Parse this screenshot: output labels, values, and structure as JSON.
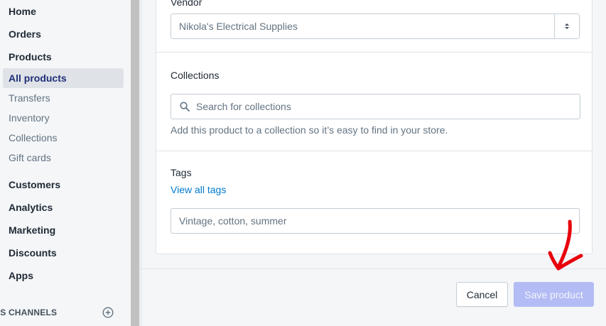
{
  "sidebar": {
    "items": [
      {
        "label": "Home",
        "type": "main"
      },
      {
        "label": "Orders",
        "type": "main"
      },
      {
        "label": "Products",
        "type": "main"
      },
      {
        "label": "All products",
        "type": "active"
      },
      {
        "label": "Transfers",
        "type": "sub"
      },
      {
        "label": "Inventory",
        "type": "sub"
      },
      {
        "label": "Collections",
        "type": "sub"
      },
      {
        "label": "Gift cards",
        "type": "sub"
      },
      {
        "label": "Customers",
        "type": "main"
      },
      {
        "label": "Analytics",
        "type": "main"
      },
      {
        "label": "Marketing",
        "type": "main"
      },
      {
        "label": "Discounts",
        "type": "main"
      },
      {
        "label": "Apps",
        "type": "main"
      }
    ],
    "channels_label": "ES CHANNELS",
    "add_channel_icon": "plus-circle-icon"
  },
  "vendor": {
    "label": "Vendor",
    "value": "Nikola's Electrical Supplies",
    "arrows_icon": "select-arrows-icon"
  },
  "collections": {
    "label": "Collections",
    "placeholder": "Search for collections",
    "help": "Add this product to a collection so it’s easy to find in your store.",
    "search_icon": "search-icon"
  },
  "tags": {
    "label": "Tags",
    "view_all": "View all tags",
    "placeholder": "Vintage, cotton, summer"
  },
  "footer": {
    "cancel_label": "Cancel",
    "save_label": "Save product"
  },
  "colors": {
    "accent": "#202e78",
    "active_bg": "#dfe3e8",
    "link": "#007ace",
    "save_disabled": "#b3bcf5",
    "annotation_red": "#e8000b"
  }
}
